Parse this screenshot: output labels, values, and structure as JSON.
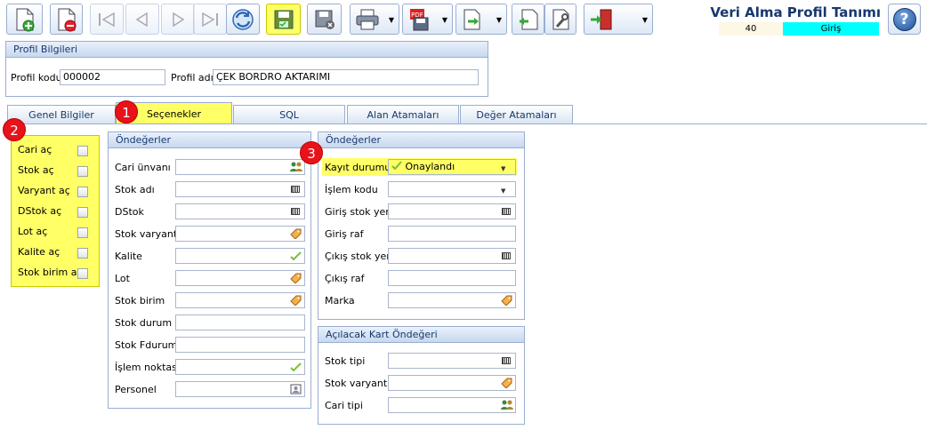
{
  "window": {
    "title": "Veri Alma Profil Tanımı",
    "code": "40",
    "mode": "Giriş",
    "help_label": "?"
  },
  "profile": {
    "group_title": "Profil Bilgileri",
    "code_label": "Profil kodu",
    "code_value": "000002",
    "name_label": "Profil adı",
    "name_value": "ÇEK BORDRO AKTARIMI"
  },
  "tabs": [
    {
      "label": "Genel Bilgiler"
    },
    {
      "label": "Seçenekler"
    },
    {
      "label": "SQL"
    },
    {
      "label": "Alan Atamaları"
    },
    {
      "label": "Değer Atamaları"
    }
  ],
  "badges": [
    "1",
    "2",
    "3"
  ],
  "options": [
    {
      "label": "Cari aç",
      "checked": false
    },
    {
      "label": "Stok aç",
      "checked": false
    },
    {
      "label": "Varyant aç",
      "checked": false
    },
    {
      "label": "DStok aç",
      "checked": false
    },
    {
      "label": "Lot aç",
      "checked": false
    },
    {
      "label": "Kalite aç",
      "checked": false
    },
    {
      "label": "Stok birim aç",
      "checked": false
    }
  ],
  "defaults_left": {
    "title": "Öndeğerler",
    "fields": [
      {
        "label": "Cari ünvanı",
        "value": "",
        "icon": "people-icon"
      },
      {
        "label": "Stok adı",
        "value": "",
        "icon": "barcode-icon"
      },
      {
        "label": "DStok",
        "value": "",
        "icon": "barcode-icon"
      },
      {
        "label": "Stok varyant",
        "value": "",
        "icon": "tag-icon"
      },
      {
        "label": "Kalite",
        "value": "",
        "icon": "check-icon"
      },
      {
        "label": "Lot",
        "value": "",
        "icon": "tag-icon"
      },
      {
        "label": "Stok birim",
        "value": "",
        "icon": "tag-icon"
      },
      {
        "label": "Stok durum",
        "value": "",
        "icon": ""
      },
      {
        "label": "Stok Fdurum",
        "value": "",
        "icon": ""
      },
      {
        "label": "İşlem noktası",
        "value": "",
        "icon": "check-icon"
      },
      {
        "label": "Personel",
        "value": "",
        "icon": "person-card-icon"
      }
    ]
  },
  "defaults_right": {
    "title": "Öndeğerler",
    "fields": [
      {
        "label": "Kayıt durumu",
        "value": "Onaylandı",
        "icon": "dropdown"
      },
      {
        "label": "İşlem kodu",
        "value": "",
        "icon": "dropdown"
      },
      {
        "label": "Giriş stok yeri",
        "value": "",
        "icon": "barcode-icon"
      },
      {
        "label": "Giriş raf",
        "value": "",
        "icon": ""
      },
      {
        "label": "Çıkış stok yeri",
        "value": "",
        "icon": "barcode-icon"
      },
      {
        "label": "Çıkış raf",
        "value": "",
        "icon": ""
      },
      {
        "label": "Marka",
        "value": "",
        "icon": "tag-icon"
      }
    ]
  },
  "card_defaults": {
    "title": "Açılacak Kart Öndeğeri",
    "fields": [
      {
        "label": "Stok tipi",
        "value": "",
        "icon": "barcode-icon"
      },
      {
        "label": "Stok varyantı",
        "value": "",
        "icon": "tag-icon"
      },
      {
        "label": "Cari tipi",
        "value": "",
        "icon": "people-icon"
      }
    ]
  },
  "colors": {
    "highlight": "#ffff66",
    "accent": "#16386e",
    "mode_bg": "#00ffff",
    "badge": "#e8121b"
  }
}
